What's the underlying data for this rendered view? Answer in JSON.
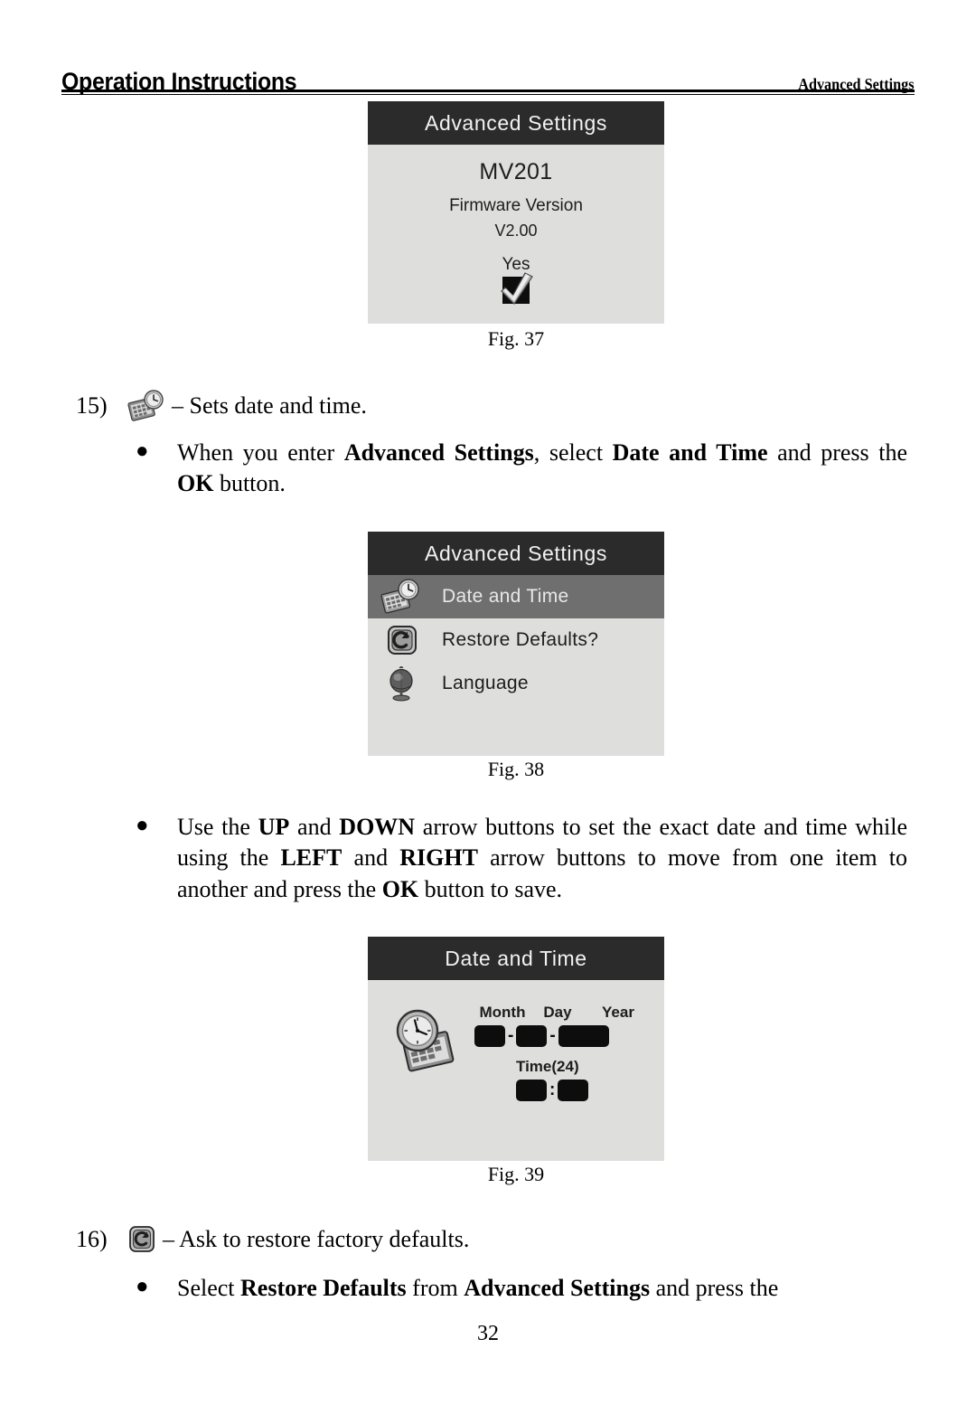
{
  "header": {
    "left_title": "Operation Instructions",
    "right_title": "Advanced Settings"
  },
  "figures": {
    "fig37": {
      "caption": "Fig. 37",
      "screen_title": "Advanced Settings",
      "model": "MV201",
      "firmware_label": "Firmware Version",
      "firmware_value": "V2.00",
      "confirm_label": "Yes",
      "checkbox_icon": "checkmark-icon"
    },
    "fig38": {
      "caption": "Fig. 38",
      "screen_title": "Advanced Settings",
      "items": [
        {
          "label": "Date and Time",
          "icon": "calendar-clock-icon",
          "selected": true
        },
        {
          "label": "Restore Defaults?",
          "icon": "restore-icon",
          "selected": false
        },
        {
          "label": "Language",
          "icon": "globe-icon",
          "selected": false
        }
      ]
    },
    "fig39": {
      "caption": "Fig. 39",
      "screen_title": "Date and Time",
      "icon": "clock-calendar-icon",
      "date_labels": [
        "Month",
        "Day",
        "Year"
      ],
      "date_separator": "-",
      "time_label": "Time(24)",
      "time_separator": ":"
    }
  },
  "items": {
    "item15": {
      "number": "15)",
      "icon": "calendar-clock-icon",
      "text": "– Sets date and time.",
      "bullet_marker": "●",
      "bullet": {
        "seg1": "When you enter ",
        "bold1": "Advanced Settings",
        "seg2": ", select ",
        "bold2": "Date and Time",
        "seg3": " and press the ",
        "bold3": "OK",
        "seg4": " button."
      }
    },
    "bullet_arrows": {
      "bullet_marker": "●",
      "seg1": "Use the ",
      "bold1": "UP",
      "seg2": " and ",
      "bold2": "DOWN",
      "seg3": " arrow buttons to set the exact date and time while using the ",
      "bold3": "LEFT",
      "seg4": " and ",
      "bold4": "RIGHT",
      "seg5": " arrow buttons to move from one item to another and press the ",
      "bold5": "OK",
      "seg6": " button to save."
    },
    "item16": {
      "number": "16)",
      "icon": "restore-icon",
      "text": "– Ask to restore factory defaults.",
      "bullet_marker": "●",
      "bullet": {
        "seg1": "Select ",
        "bold1": "Restore Defaults",
        "seg2": " from ",
        "bold2": "Advanced Settings",
        "seg3": " and press the"
      }
    }
  },
  "page_number": "32",
  "colors": {
    "screen_header_bg": "#2b2b2b",
    "screen_body_bg": "#dededd",
    "selected_row_bg": "#6f6f6f",
    "field_box": "#0d0d0d"
  }
}
